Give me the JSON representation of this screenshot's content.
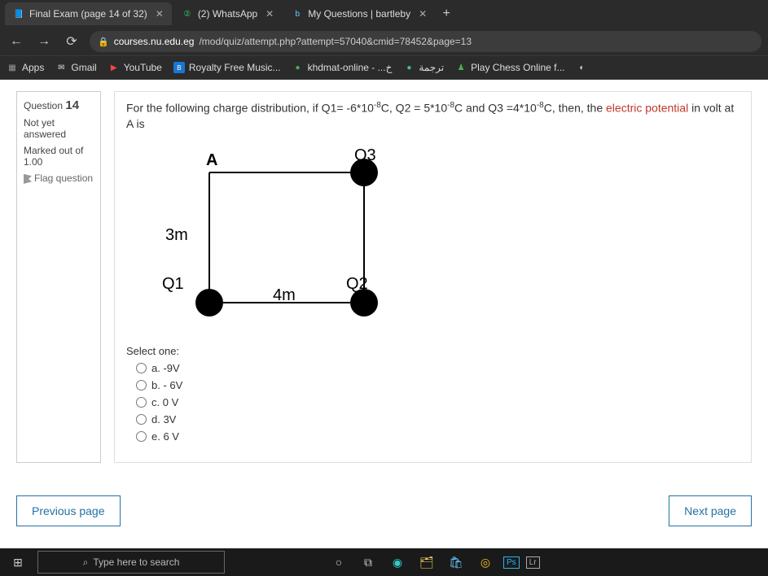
{
  "tabs": [
    {
      "label": "Final Exam (page 14 of 32)"
    },
    {
      "label": "(2) WhatsApp"
    },
    {
      "label": "My Questions | bartleby"
    }
  ],
  "url": {
    "domain": "courses.nu.edu.eg",
    "path": "/mod/quiz/attempt.php?attempt=57040&cmid=78452&page=13"
  },
  "bookmarks": {
    "apps": "Apps",
    "gmail": "Gmail",
    "youtube": "YouTube",
    "royalty": "Royalty Free Music...",
    "khdmat": "khdmat-online - ...خ",
    "tarjama": "ترجمة",
    "chess": "Play Chess Online f..."
  },
  "qnav": {
    "qlabel": "Question",
    "qnum": "14",
    "status": "Not yet answered",
    "marked_label": "Marked out of",
    "marked_val": "1.00",
    "flag": "Flag question"
  },
  "question": {
    "pre": "For the following charge distribution, if Q1= -6*10",
    "exp1": "-8",
    "mid1": "C, Q2 = 5*10",
    "exp2": "-8",
    "mid2": "C and Q3 =4*10",
    "exp3": "-8",
    "post1": "C, then, the ",
    "ep": "electric potential",
    "post2": " in volt at A is"
  },
  "diagram": {
    "A": "A",
    "Q1": "Q1",
    "Q2": "Q2",
    "Q3": "Q3",
    "h": "3m",
    "w": "4m"
  },
  "select_label": "Select one:",
  "options": [
    {
      "text": "a. -9V"
    },
    {
      "text": "b. - 6V"
    },
    {
      "text": "c. 0 V"
    },
    {
      "text": "d. 3V"
    },
    {
      "text": "e. 6 V"
    }
  ],
  "pager": {
    "prev": "Previous page",
    "next": "Next page"
  },
  "taskbar": {
    "search_placeholder": "Type here to search",
    "ps": "Ps",
    "lr": "Lr"
  }
}
